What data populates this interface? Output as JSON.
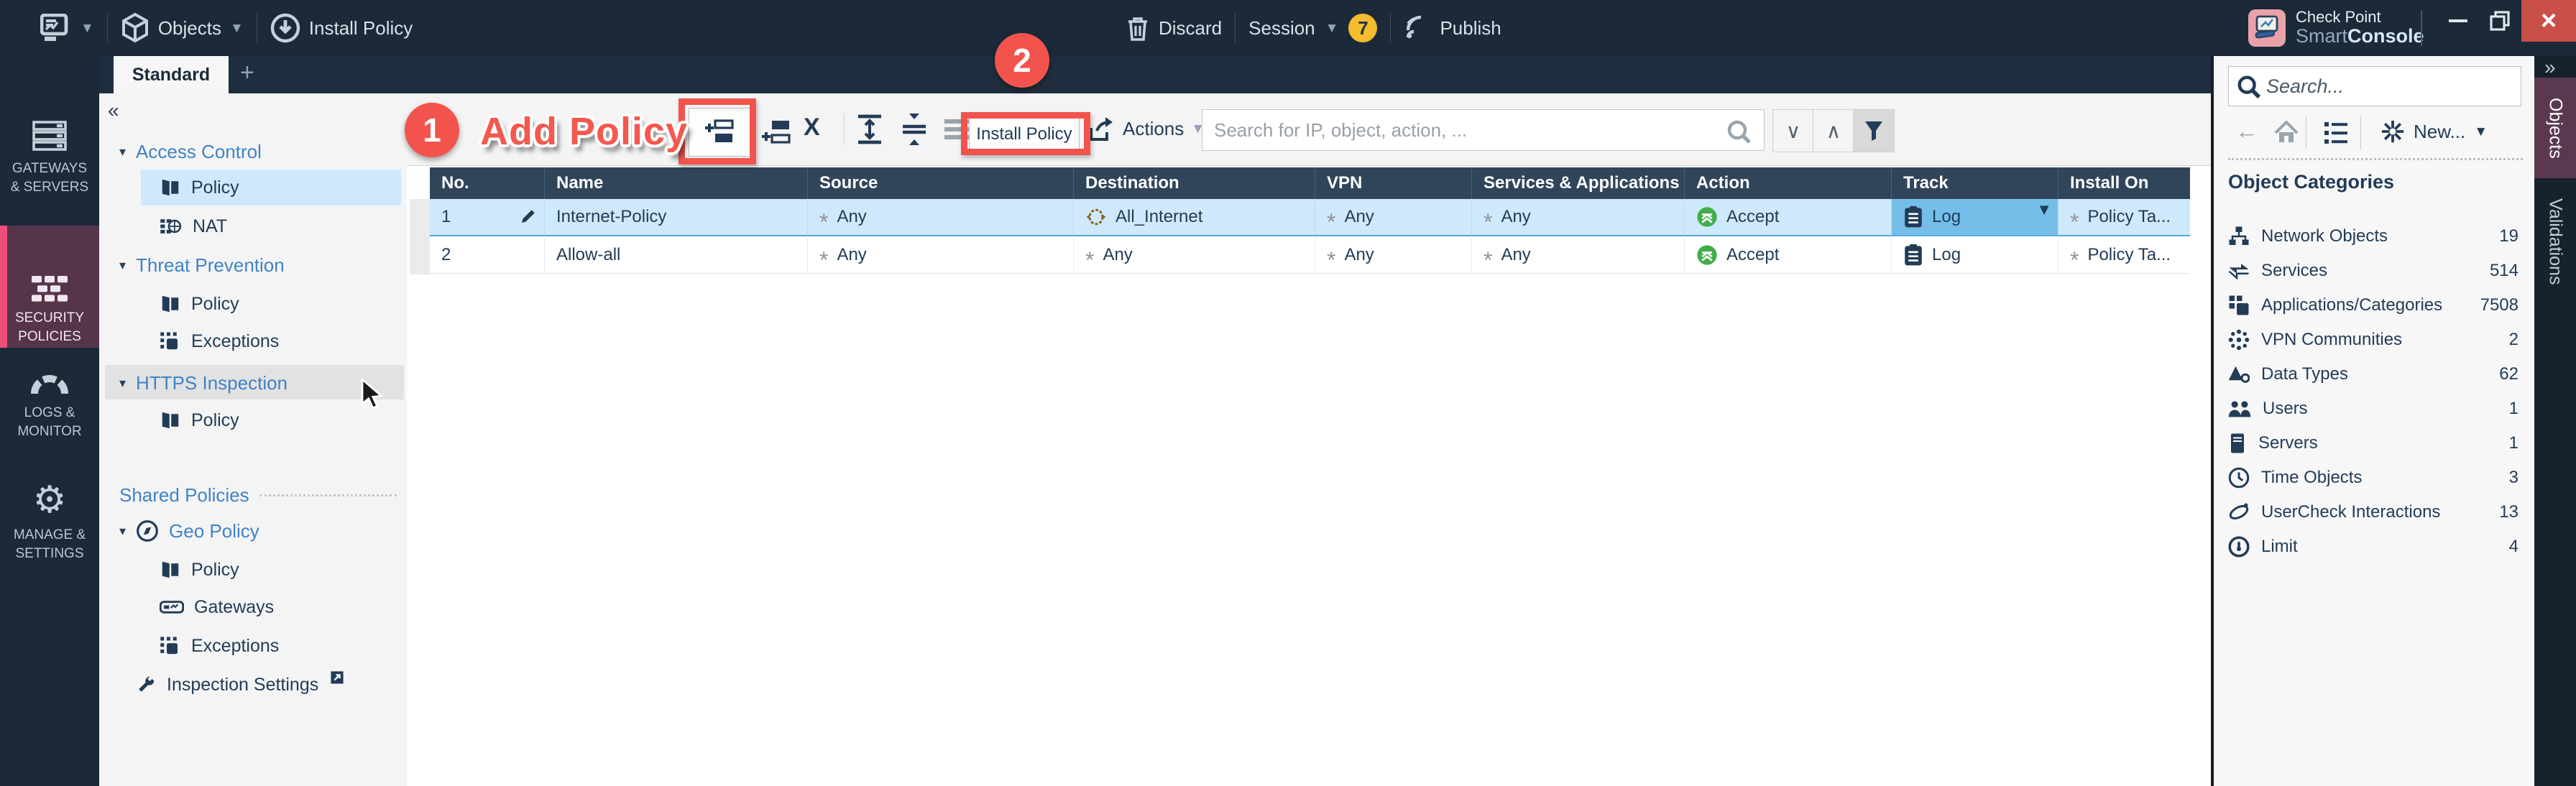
{
  "colors": {
    "topbar_bg": "#1b2938",
    "rail_active_bg": "#56344a",
    "rail_accent": "#ee4e7c",
    "tree_link": "#3f83c6",
    "selected_item_bg": "#cfe8fb",
    "table_header_bg": "#31455a",
    "selected_row_bg": "#cde9fb",
    "selected_cell_bg": "#74bee9",
    "accept_green": "#3fae49",
    "annotation_red": "#f2544d",
    "session_badge_yellow": "#f3bd2e",
    "close_red": "#c9504a"
  },
  "topbar": {
    "objects_label": "Objects",
    "install_policy_label": "Install Policy",
    "discard_label": "Discard",
    "session_label": "Session",
    "session_badge": "7",
    "publish_label": "Publish",
    "brand_line1": "Check Point",
    "brand_smart": "Smart",
    "brand_console": "Console"
  },
  "tabs": {
    "active": "Standard",
    "add": "+"
  },
  "sidebar": {
    "items": [
      {
        "line1": "GATEWAYS",
        "line2": "& SERVERS"
      },
      {
        "line1": "SECURITY",
        "line2": "POLICIES"
      },
      {
        "line1": "LOGS &",
        "line2": "MONITOR"
      },
      {
        "line1": "MANAGE &",
        "line2": "SETTINGS"
      }
    ]
  },
  "nav": {
    "collapse_glyph": "«",
    "access_control": "Access Control",
    "ac_policy": "Policy",
    "ac_nat": "NAT",
    "threat_prevention": "Threat Prevention",
    "tp_policy": "Policy",
    "tp_exceptions": "Exceptions",
    "https_inspection": "HTTPS Inspection",
    "https_policy": "Policy",
    "shared_policies": "Shared Policies",
    "geo_policy": "Geo Policy",
    "geo_policy_policy": "Policy",
    "geo_gateways": "Gateways",
    "geo_exceptions": "Exceptions",
    "inspection_settings": "Inspection Settings"
  },
  "annotations": {
    "step1": "1",
    "step1_label": "Add Policy",
    "step2": "2"
  },
  "toolbar": {
    "install_policy_label": "Install Policy",
    "actions_label": "Actions",
    "search_placeholder": "Search for IP, object, action, ..."
  },
  "table": {
    "columns": [
      "No.",
      "Name",
      "Source",
      "Destination",
      "VPN",
      "Services & Applications",
      "Action",
      "Track",
      "Install On"
    ],
    "rows": [
      {
        "no": "1",
        "name": "Internet-Policy",
        "source": "Any",
        "destination": "All_Internet",
        "vpn": "Any",
        "services": "Any",
        "action": "Accept",
        "track": "Log",
        "install_on": "Policy Ta..."
      },
      {
        "no": "2",
        "name": "Allow-all",
        "source": "Any",
        "destination": "Any",
        "vpn": "Any",
        "services": "Any",
        "action": "Accept",
        "track": "Log",
        "install_on": "Policy Ta..."
      }
    ]
  },
  "objects_panel": {
    "search_placeholder": "Search...",
    "new_label": "New...",
    "header": "Object Categories",
    "categories": [
      {
        "name": "Network Objects",
        "count": "19"
      },
      {
        "name": "Services",
        "count": "514"
      },
      {
        "name": "Applications/Categories",
        "count": "7508"
      },
      {
        "name": "VPN Communities",
        "count": "2"
      },
      {
        "name": "Data Types",
        "count": "62"
      },
      {
        "name": "Users",
        "count": "1"
      },
      {
        "name": "Servers",
        "count": "1"
      },
      {
        "name": "Time Objects",
        "count": "3"
      },
      {
        "name": "UserCheck Interactions",
        "count": "13"
      },
      {
        "name": "Limit",
        "count": "4"
      }
    ]
  },
  "right_tabs": {
    "expand_glyph": "»",
    "objects": "Objects",
    "validations": "Validations"
  }
}
